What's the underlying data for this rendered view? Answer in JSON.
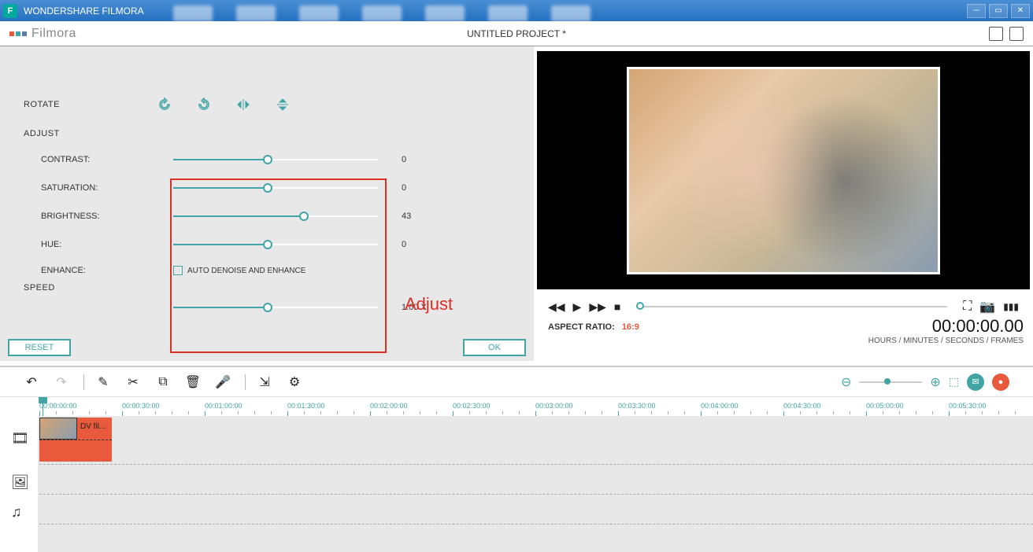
{
  "titlebar": {
    "app_name": "WONDERSHARE FILMORA",
    "icon_letter": "F"
  },
  "header": {
    "logo": "Filmora",
    "project": "UNTITLED PROJECT *"
  },
  "rotate": {
    "label": "ROTATE"
  },
  "adjust": {
    "label": "ADJUST",
    "contrast": {
      "label": "CONTRAST:",
      "value": "0",
      "pct": 46
    },
    "saturation": {
      "label": "SATURATION:",
      "value": "0",
      "pct": 46
    },
    "brightness": {
      "label": "BRIGHTNESS:",
      "value": "43",
      "pct": 64
    },
    "hue": {
      "label": "HUE:",
      "value": "0",
      "pct": 46
    },
    "enhance": {
      "label": "ENHANCE:",
      "checkbox": "AUTO DENOISE AND ENHANCE"
    },
    "annotation": "Adjust"
  },
  "speed": {
    "label": "SPEED",
    "value": "1.00 X",
    "pct": 46
  },
  "buttons": {
    "reset": "RESET",
    "ok": "OK"
  },
  "preview": {
    "aspect_label": "ASPECT RATIO:",
    "aspect_value": "16:9",
    "timecode": "00:00:00.00",
    "timecode_label": "HOURS / MINUTES / SECONDS / FRAMES"
  },
  "ruler": {
    "ticks": [
      "00:00:00:00",
      "00:00:30:00",
      "00:01:00:00",
      "00:01:30:00",
      "00:02:00:00",
      "00:02:30:00",
      "00:03:00:00",
      "00:03:30:00",
      "00:04:00:00",
      "00:04:30:00",
      "00:05:00:00",
      "00:05:30:00"
    ]
  },
  "clip": {
    "label": "DV fil..."
  }
}
